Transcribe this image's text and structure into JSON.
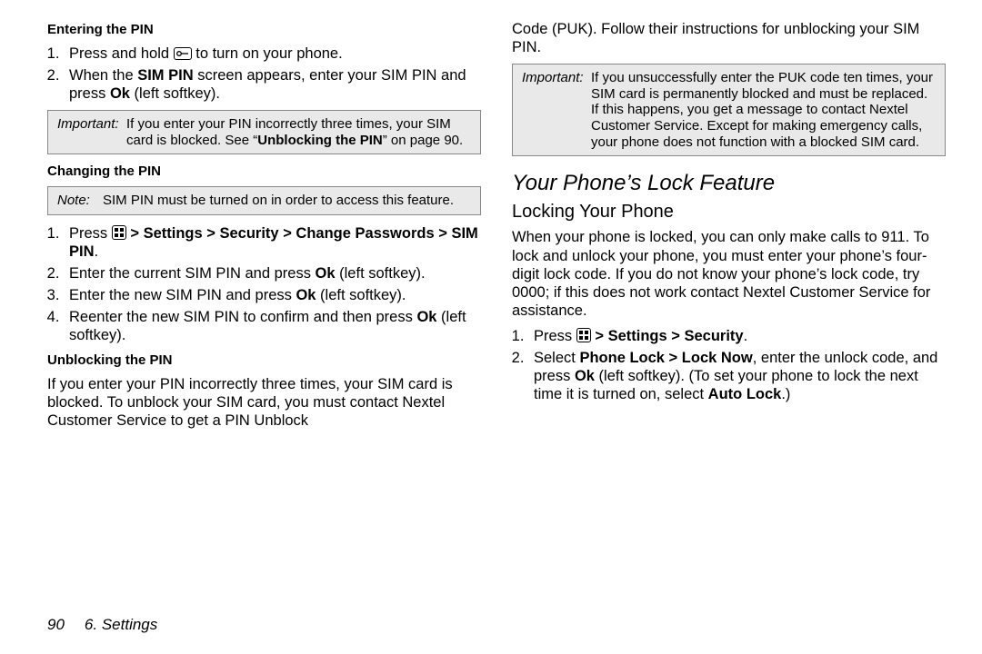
{
  "left": {
    "h_enter": "Entering the PIN",
    "enter_step1_a": "Press and hold ",
    "enter_step1_b": " to turn on your phone.",
    "enter_step2_a": "When the ",
    "enter_step2_b": "SIM PIN",
    "enter_step2_c": " screen appears, enter your SIM PIN and press ",
    "enter_step2_d": "Ok",
    "enter_step2_e": " (left softkey).",
    "important1_lbl": "Important:",
    "important1_a": "If you enter your PIN incorrectly three times, your SIM card is blocked. See “",
    "important1_b": "Unblocking the PIN",
    "important1_c": "” on page 90.",
    "h_change": "Changing the PIN",
    "note1_lbl": "Note:",
    "note1_body": "SIM PIN must be turned on in order to access this feature.",
    "change_step1_a": "Press ",
    "change_step1_b": " > ",
    "change_step1_c": "Settings",
    "change_step1_d": " > ",
    "change_step1_e": "Security",
    "change_step1_f": " > ",
    "change_step1_g": "Change Passwords",
    "change_step1_h": " > ",
    "change_step1_i": "SIM PIN",
    "change_step1_j": ".",
    "change_step2_a": "Enter the current SIM PIN and press ",
    "change_step2_b": "Ok",
    "change_step2_c": " (left softkey).",
    "change_step3_a": "Enter the new SIM PIN and press ",
    "change_step3_b": "Ok",
    "change_step3_c": " (left softkey).",
    "change_step4_a": "Reenter the new SIM PIN to confirm and then press ",
    "change_step4_b": "Ok",
    "change_step4_c": " (left softkey).",
    "h_unblock": "Unblocking the PIN",
    "unblock_body": "If you enter your PIN incorrectly three times, your SIM card is blocked. To unblock your SIM card, you must contact Nextel Customer Service to get a PIN Unblock"
  },
  "right": {
    "cont_body": "Code (PUK). Follow their instructions for unblocking your SIM PIN.",
    "important2_lbl": "Important:",
    "important2_body": "If you unsuccessfully enter the PUK code ten times, your SIM card is permanently blocked and must be replaced. If this happens, you get a message to contact Nextel Customer Service. Except for making emergency calls, your phone does not function with a blocked SIM card.",
    "h_lock": "Your Phone’s Lock Feature",
    "h_locking": "Locking Your Phone",
    "lock_body": "When your phone is locked, you can only make calls to 911. To lock and unlock your phone, you must enter your phone’s four-digit lock code. If you do not know your phone’s lock code, try 0000; if this does not work contact Nextel Customer Service for assistance.",
    "lock_step1_a": "Press ",
    "lock_step1_b": " > ",
    "lock_step1_c": "Settings",
    "lock_step1_d": " > ",
    "lock_step1_e": "Security",
    "lock_step1_f": ".",
    "lock_step2_a": "Select ",
    "lock_step2_b": "Phone Lock",
    "lock_step2_c": " > ",
    "lock_step2_d": "Lock Now",
    "lock_step2_e": ", enter the unlock code, and press ",
    "lock_step2_f": "Ok",
    "lock_step2_g": " (left softkey). (To set your phone to lock the next time it is turned on, select ",
    "lock_step2_h": "Auto Lock",
    "lock_step2_i": ".)"
  },
  "footer": {
    "page_no": "90",
    "chapter": "6. Settings"
  }
}
